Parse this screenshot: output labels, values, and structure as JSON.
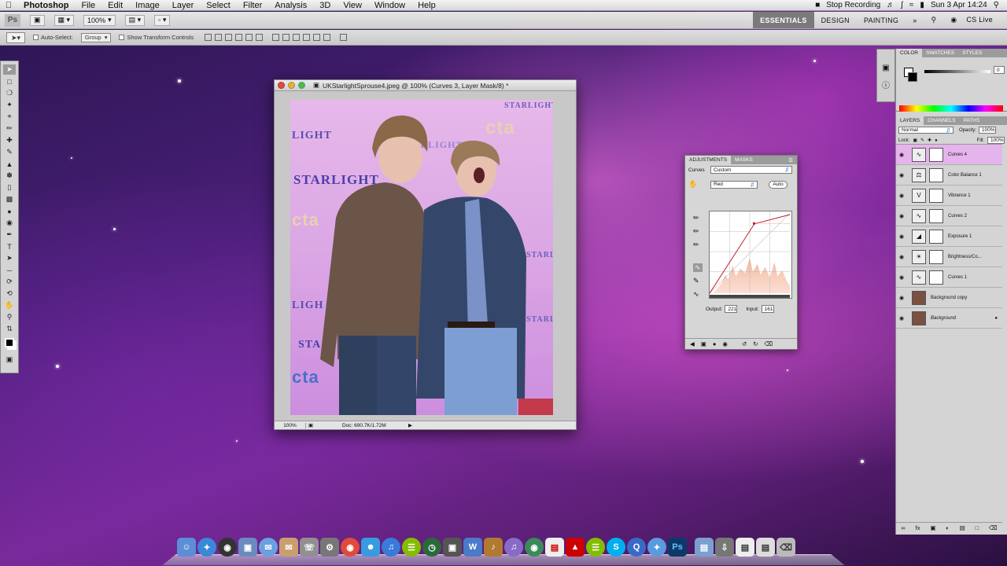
{
  "menubar": {
    "app": "Photoshop",
    "items": [
      "File",
      "Edit",
      "Image",
      "Layer",
      "Select",
      "Filter",
      "Analysis",
      "3D",
      "View",
      "Window",
      "Help"
    ],
    "recording": "Stop Recording",
    "clock": "Sun 3 Apr  14:24"
  },
  "appbar": {
    "zoom": "100%",
    "workspaces": [
      "ESSENTIALS",
      "DESIGN",
      "PAINTING"
    ],
    "more": "»",
    "cslive": "CS Live"
  },
  "options": {
    "auto_select": "Auto-Select:",
    "group": "Group",
    "show_transform": "Show Transform Controls"
  },
  "document": {
    "title": "UKStarlightSprouse4.jpeg @ 100% (Curves 3, Layer Mask/8) *",
    "zoom": "100%",
    "doc_info": "Doc: 690.7K/1.72M",
    "watermarks": [
      "LIGHT",
      "STARLIGHT",
      "cta",
      "STARLIGHT",
      "cta",
      "LIGH",
      "cta",
      "STA",
      "STARLIGHT",
      "cta",
      "STARLIGHT",
      "STARLIGHT",
      "cta"
    ]
  },
  "adjustments": {
    "tabs": [
      "ADJUSTMENTS",
      "MASKS"
    ],
    "label": "Curves",
    "preset": "Custom",
    "channel": "Red",
    "auto": "Auto",
    "output_label": "Output:",
    "output_value": "221",
    "input_label": "Input:",
    "input_value": "161"
  },
  "color_panel": {
    "tabs": [
      "COLOR",
      "SWATCHES",
      "STYLES"
    ],
    "value": "0"
  },
  "layers_panel": {
    "tabs": [
      "LAYERS",
      "CHANNELS",
      "PATHS"
    ],
    "mode": "Normal",
    "opacity_label": "Opacity:",
    "opacity": "100%",
    "lock_label": "Lock:",
    "fill_label": "Fill:",
    "fill": "100%",
    "layers": [
      {
        "name": "Curves 4",
        "icon": "curves-icon"
      },
      {
        "name": "Color Balance 1",
        "icon": "balance-icon"
      },
      {
        "name": "Vibrance 1",
        "icon": "vibrance-icon"
      },
      {
        "name": "Curves 2",
        "icon": "curves-icon"
      },
      {
        "name": "Exposure 1",
        "icon": "exposure-icon"
      },
      {
        "name": "Brightness/Co...",
        "icon": "brightness-icon"
      },
      {
        "name": "Curves 1",
        "icon": "curves-icon"
      },
      {
        "name": "Background copy",
        "icon": "photo-icon"
      },
      {
        "name": "Background",
        "icon": "photo-icon"
      }
    ]
  },
  "dock": {
    "icons": [
      "finder-icon",
      "safari-icon",
      "dashboard-icon",
      "preview-icon",
      "ichat-icon",
      "mail-icon",
      "address-book-icon",
      "system-prefs-icon",
      "chrome-icon",
      "people-icon",
      "itunes-icon",
      "spotify-icon",
      "time-machine-icon",
      "photo-booth-icon",
      "word-icon",
      "garageband-icon",
      "itunes-2-icon",
      "earth-icon",
      "calendar-icon",
      "acrobat-icon",
      "spotify-2-icon",
      "skype-icon",
      "quicktime-icon",
      "safari-2-icon",
      "photoshop-icon",
      "folder-icon",
      "downloads-icon",
      "documents-icon",
      "stack-icon",
      "trash-icon"
    ],
    "ps_label": "Ps"
  }
}
